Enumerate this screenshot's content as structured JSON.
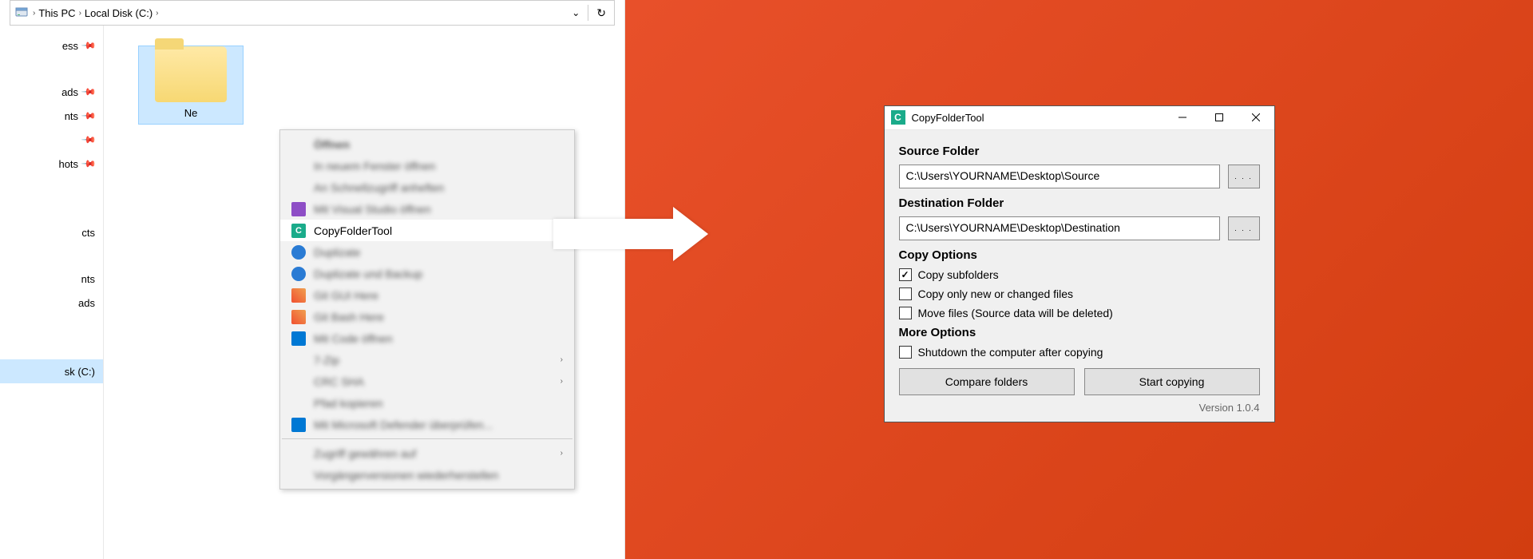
{
  "explorer": {
    "breadcrumb": {
      "seg1": "This PC",
      "seg2": "Local Disk (C:)"
    },
    "sidebar": {
      "items": [
        {
          "label": "ess",
          "pinned": true
        },
        {
          "label": "ads",
          "pinned": true
        },
        {
          "label": "nts",
          "pinned": true
        },
        {
          "label": "",
          "pinned": true
        },
        {
          "label": "hots",
          "pinned": true
        },
        {
          "label": "",
          "pinned": false,
          "spacer": true
        },
        {
          "label": "",
          "pinned": false,
          "spacer": true
        },
        {
          "label": "cts",
          "pinned": false
        },
        {
          "label": "",
          "pinned": false,
          "spacer": true
        },
        {
          "label": "nts",
          "pinned": false
        },
        {
          "label": "ads",
          "pinned": false
        },
        {
          "label": "",
          "pinned": false,
          "spacer": true
        },
        {
          "label": "",
          "pinned": false,
          "spacer": true
        },
        {
          "label": "sk (C:)",
          "pinned": false,
          "selected": true
        }
      ]
    },
    "folder": {
      "label": "Ne"
    },
    "ctx": {
      "icon_letter": "C",
      "highlighted_label": "CopyFolderTool",
      "blurred": {
        "b0": "Öffnen",
        "b1": "In neuem Fenster öffnen",
        "b2": "An Schnellzugriff anheften",
        "b3": "Mit Visual Studio öffnen",
        "b5": "Duplizate",
        "b6": "Duplizate und Backup",
        "b7": "Git GUI Here",
        "b8": "Git Bash Here",
        "b9": "Mit Code öffnen",
        "b10": "7-Zip",
        "b11": "CRC SHA",
        "b12": "Pfad kopieren",
        "b13": "Mit Microsoft Defender überprüfen...",
        "b14": "Zugriff gewähren auf",
        "b15": "Vorgängerversionen wiederherstellen"
      }
    }
  },
  "app": {
    "title": "CopyFolderTool",
    "source_label": "Source Folder",
    "source_value": "C:\\Users\\YOURNAME\\Desktop\\Source",
    "dest_label": "Destination Folder",
    "dest_value": "C:\\Users\\YOURNAME\\Desktop\\Destination",
    "copy_options_label": "Copy Options",
    "chk_subfolders": "Copy subfolders",
    "chk_newchanged": "Copy only new or changed files",
    "chk_move": "Move files (Source data will be deleted)",
    "more_options_label": "More Options",
    "chk_shutdown": "Shutdown the computer after copying",
    "btn_compare": "Compare folders",
    "btn_start": "Start copying",
    "browse_label": ". . .",
    "version": "Version 1.0.4"
  }
}
